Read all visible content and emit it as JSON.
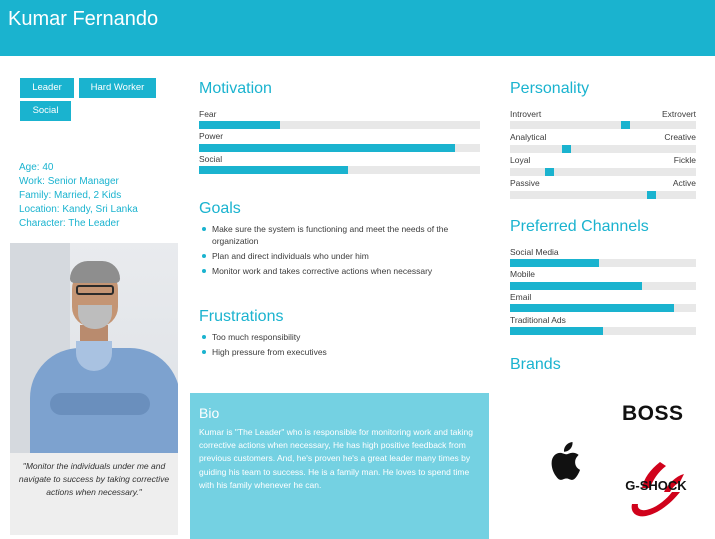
{
  "persona": {
    "name": "Kumar Fernando"
  },
  "tags": [
    "Leader",
    "Hard Worker",
    "Social"
  ],
  "info": {
    "age": "Age: 40",
    "work": "Work: Senior Manager",
    "family": "Family: Married, 2 Kids",
    "location": "Location: Kandy, Sri Lanka",
    "character": "Character: The Leader"
  },
  "quote": "\"Monitor the individuals under me and navigate to success by taking corrective actions when necessary.\"",
  "motivation": {
    "title": "Motivation",
    "items": [
      {
        "label": "Fear",
        "value": 0.29
      },
      {
        "label": "Power",
        "value": 0.91
      },
      {
        "label": "Social",
        "value": 0.53
      }
    ]
  },
  "goals": {
    "title": "Goals",
    "items": [
      "Make sure the system is functioning and meet the needs of the organization",
      "Plan and direct individuals who under him",
      "Monitor work and takes corrective actions when necessary"
    ]
  },
  "frustrations": {
    "title": "Frustrations",
    "items": [
      "Too much responsibility",
      "High pressure from executives"
    ]
  },
  "bio": {
    "title": "Bio",
    "text": "Kumar is \"The Leader\" who is responsible for monitoring work and taking corrective actions when necessary, He has high positive feedback from previous customers. And, he's proven he's a great leader many times by guiding his team to success. He is a family man. He loves to spend time with his family whenever he can."
  },
  "personality": {
    "title": "Personality",
    "items": [
      {
        "left": "Introvert",
        "right": "Extrovert",
        "value": 0.62
      },
      {
        "left": "Analytical",
        "right": "Creative",
        "value": 0.3
      },
      {
        "left": "Loyal",
        "right": "Fickle",
        "value": 0.21
      },
      {
        "left": "Passive",
        "right": "Active",
        "value": 0.76
      }
    ]
  },
  "channels": {
    "title": "Preferred Channels",
    "items": [
      {
        "label": "Social Media",
        "value": 0.48
      },
      {
        "label": "Mobile",
        "value": 0.71
      },
      {
        "label": "Email",
        "value": 0.88
      },
      {
        "label": "Traditional Ads",
        "value": 0.5
      }
    ]
  },
  "brands": {
    "title": "Brands",
    "boss": "BOSS",
    "gshock": "G-SHOCK",
    "apple_icon": "apple-logo-icon"
  },
  "colors": {
    "accent": "#1ab3cf",
    "bio_bg": "#74d1e2",
    "track": "#e8e8e8"
  }
}
